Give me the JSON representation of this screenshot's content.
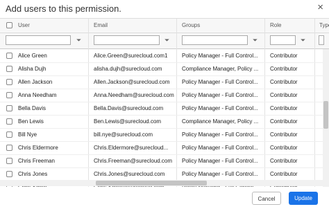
{
  "dialog": {
    "title": "Add users to this permission.",
    "close_symbol": "×"
  },
  "columns": [
    "User",
    "Email",
    "Groups",
    "Role",
    "Type"
  ],
  "rows": [
    {
      "user": "Alice Green",
      "email": "Alice.Green@surecloud.com1",
      "groups": "Policy Manager - Full Control...",
      "role": "Contributor"
    },
    {
      "user": "Alisha Dujh",
      "email": "alisha.dujh@surecloud.com",
      "groups": "Compliance Manager, Policy ...",
      "role": "Contributor"
    },
    {
      "user": "Allen Jackson",
      "email": "Allen.Jackson@surecloud.com",
      "groups": "Policy Manager - Full Control...",
      "role": "Contributor"
    },
    {
      "user": "Anna Needham",
      "email": "Anna.Needham@surecloud.com",
      "groups": "Policy Manager - Full Control...",
      "role": "Contributor"
    },
    {
      "user": "Bella Davis",
      "email": "Bella.Davis@surecloud.com",
      "groups": "Policy Manager - Full Control...",
      "role": "Contributor"
    },
    {
      "user": "Ben Lewis",
      "email": "Ben.Lewis@surecloud.com",
      "groups": "Compliance Manager, Policy ...",
      "role": "Contributor"
    },
    {
      "user": "Bill Nye",
      "email": "bill.nye@surecloud.com",
      "groups": "Policy Manager - Full Control...",
      "role": "Contributor"
    },
    {
      "user": "Chris Eldermore",
      "email": "Chris.Eldermore@surecloud...",
      "groups": "Policy Manager - Full Control...",
      "role": "Contributor"
    },
    {
      "user": "Chris Freeman",
      "email": "Chris.Freeman@surecloud.com",
      "groups": "Policy Manager - Full Control...",
      "role": "Contributor"
    },
    {
      "user": "Chris Jones",
      "email": "Chris.Jones@surecloud.com",
      "groups": "Policy Manager - Full Control...",
      "role": "Contributor"
    },
    {
      "user": "Chris Smith",
      "email": "Chris.Smith@surecloud.com",
      "groups": "Policy Manager - Full Control...",
      "role": "Contributor"
    }
  ],
  "buttons": {
    "cancel": "Cancel",
    "update": "Update"
  }
}
